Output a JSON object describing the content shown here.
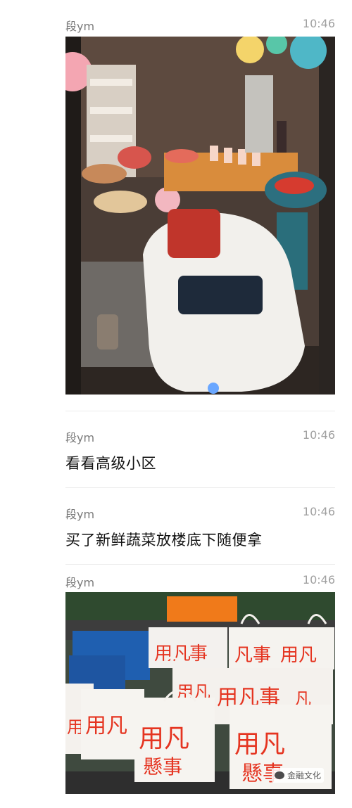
{
  "messages": [
    {
      "sender": "段ym",
      "time": "10:46",
      "type": "image",
      "image_desc": "party-room-with-toy-car-and-desserts"
    },
    {
      "sender": "段ym",
      "time": "10:46",
      "type": "text",
      "text": "看看高级小区"
    },
    {
      "sender": "段ym",
      "time": "10:46",
      "type": "text",
      "text": "买了新鲜蔬菜放楼底下随便拿"
    },
    {
      "sender": "段ym",
      "time": "10:46",
      "type": "image",
      "image_desc": "red-printed-tote-bags-on-ledge"
    }
  ],
  "bag_print": "用\n懸\n凡\n事",
  "watermark": "金融文化",
  "colors": {
    "accent_red": "#e53420",
    "orange_bag": "#f07a1a",
    "meta_gray": "#7a7a7a"
  }
}
